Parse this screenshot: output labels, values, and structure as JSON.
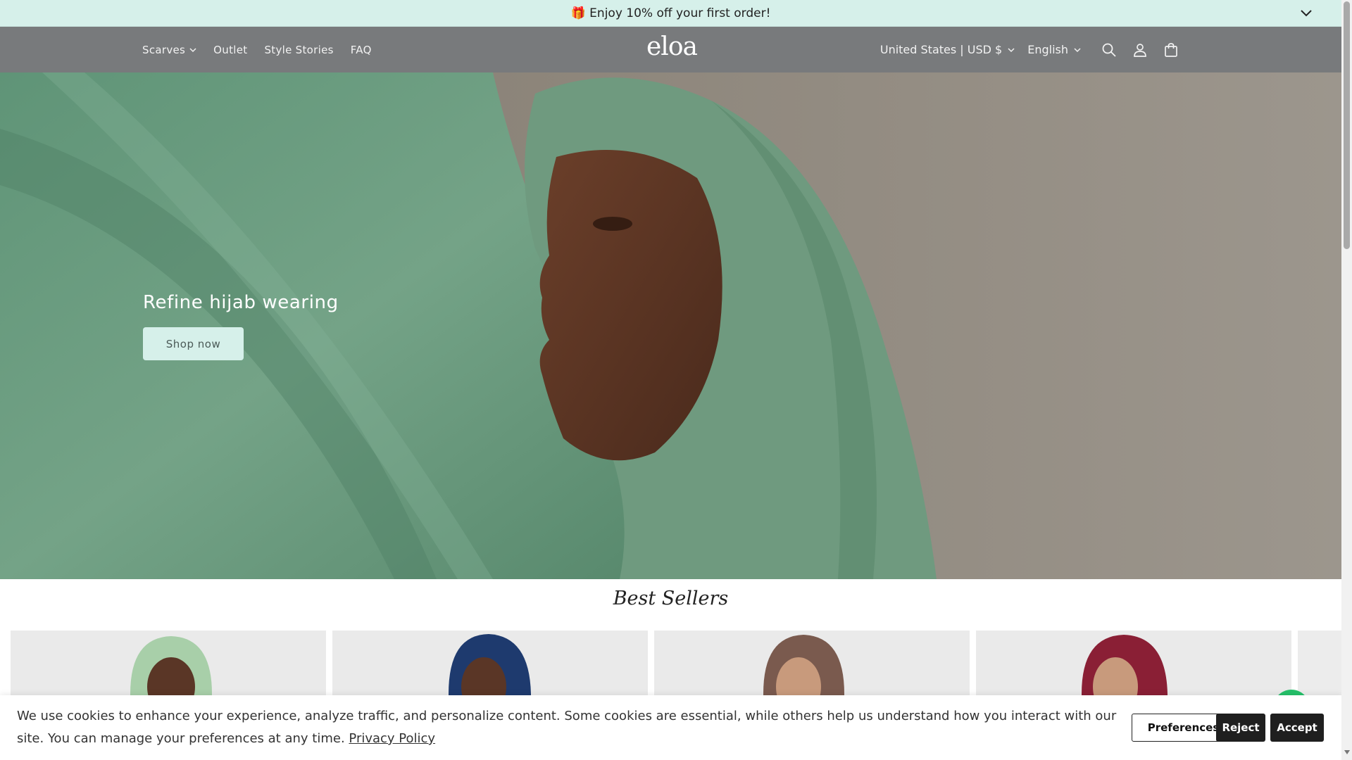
{
  "announcement": {
    "icon": "gift-icon",
    "text": "🎁 Enjoy 10% off your first order!"
  },
  "header": {
    "nav": [
      {
        "label": "Scarves",
        "has_dropdown": true
      },
      {
        "label": "Outlet"
      },
      {
        "label": "Style Stories"
      },
      {
        "label": "FAQ"
      }
    ],
    "logo": "eloa",
    "currency_selector": "United States | USD $",
    "language_selector": "English",
    "icons": [
      "search-icon",
      "account-icon",
      "cart-icon"
    ]
  },
  "hero": {
    "title": "Refine hijab wearing",
    "button": "Shop now"
  },
  "best_sellers": {
    "title": "Best Sellers",
    "products": [
      {
        "color": "#a8cfa9"
      },
      {
        "color": "#1e3a6e"
      },
      {
        "color": "#7a5a4e"
      },
      {
        "color": "#8a1f35"
      }
    ]
  },
  "cookie_banner": {
    "text": "We use cookies to enhance your experience, analyze traffic, and personalize content. Some cookies are essential, while others help us understand how you interact with our site. You can manage your preferences at any time.",
    "link": "Privacy Policy",
    "buttons": {
      "preferences": "Preferences",
      "reject": "Reject",
      "accept": "Accept"
    }
  },
  "colors": {
    "announcement_bg": "#d6f0ea",
    "header_bg": "#787a7c",
    "hijab_green": "#6f9a7f"
  }
}
